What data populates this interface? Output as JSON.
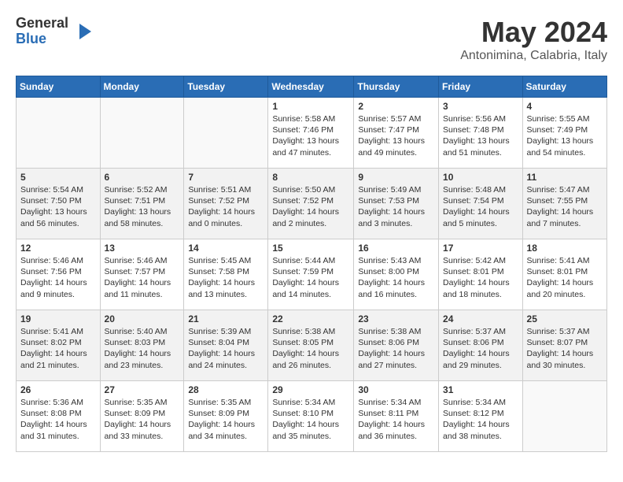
{
  "logo": {
    "general": "General",
    "blue": "Blue"
  },
  "title": "May 2024",
  "location": "Antonimina, Calabria, Italy",
  "days_of_week": [
    "Sunday",
    "Monday",
    "Tuesday",
    "Wednesday",
    "Thursday",
    "Friday",
    "Saturday"
  ],
  "weeks": [
    [
      {
        "day": "",
        "info": ""
      },
      {
        "day": "",
        "info": ""
      },
      {
        "day": "",
        "info": ""
      },
      {
        "day": "1",
        "info": "Sunrise: 5:58 AM\nSunset: 7:46 PM\nDaylight: 13 hours\nand 47 minutes."
      },
      {
        "day": "2",
        "info": "Sunrise: 5:57 AM\nSunset: 7:47 PM\nDaylight: 13 hours\nand 49 minutes."
      },
      {
        "day": "3",
        "info": "Sunrise: 5:56 AM\nSunset: 7:48 PM\nDaylight: 13 hours\nand 51 minutes."
      },
      {
        "day": "4",
        "info": "Sunrise: 5:55 AM\nSunset: 7:49 PM\nDaylight: 13 hours\nand 54 minutes."
      }
    ],
    [
      {
        "day": "5",
        "info": "Sunrise: 5:54 AM\nSunset: 7:50 PM\nDaylight: 13 hours\nand 56 minutes."
      },
      {
        "day": "6",
        "info": "Sunrise: 5:52 AM\nSunset: 7:51 PM\nDaylight: 13 hours\nand 58 minutes."
      },
      {
        "day": "7",
        "info": "Sunrise: 5:51 AM\nSunset: 7:52 PM\nDaylight: 14 hours\nand 0 minutes."
      },
      {
        "day": "8",
        "info": "Sunrise: 5:50 AM\nSunset: 7:52 PM\nDaylight: 14 hours\nand 2 minutes."
      },
      {
        "day": "9",
        "info": "Sunrise: 5:49 AM\nSunset: 7:53 PM\nDaylight: 14 hours\nand 3 minutes."
      },
      {
        "day": "10",
        "info": "Sunrise: 5:48 AM\nSunset: 7:54 PM\nDaylight: 14 hours\nand 5 minutes."
      },
      {
        "day": "11",
        "info": "Sunrise: 5:47 AM\nSunset: 7:55 PM\nDaylight: 14 hours\nand 7 minutes."
      }
    ],
    [
      {
        "day": "12",
        "info": "Sunrise: 5:46 AM\nSunset: 7:56 PM\nDaylight: 14 hours\nand 9 minutes."
      },
      {
        "day": "13",
        "info": "Sunrise: 5:46 AM\nSunset: 7:57 PM\nDaylight: 14 hours\nand 11 minutes."
      },
      {
        "day": "14",
        "info": "Sunrise: 5:45 AM\nSunset: 7:58 PM\nDaylight: 14 hours\nand 13 minutes."
      },
      {
        "day": "15",
        "info": "Sunrise: 5:44 AM\nSunset: 7:59 PM\nDaylight: 14 hours\nand 14 minutes."
      },
      {
        "day": "16",
        "info": "Sunrise: 5:43 AM\nSunset: 8:00 PM\nDaylight: 14 hours\nand 16 minutes."
      },
      {
        "day": "17",
        "info": "Sunrise: 5:42 AM\nSunset: 8:01 PM\nDaylight: 14 hours\nand 18 minutes."
      },
      {
        "day": "18",
        "info": "Sunrise: 5:41 AM\nSunset: 8:01 PM\nDaylight: 14 hours\nand 20 minutes."
      }
    ],
    [
      {
        "day": "19",
        "info": "Sunrise: 5:41 AM\nSunset: 8:02 PM\nDaylight: 14 hours\nand 21 minutes."
      },
      {
        "day": "20",
        "info": "Sunrise: 5:40 AM\nSunset: 8:03 PM\nDaylight: 14 hours\nand 23 minutes."
      },
      {
        "day": "21",
        "info": "Sunrise: 5:39 AM\nSunset: 8:04 PM\nDaylight: 14 hours\nand 24 minutes."
      },
      {
        "day": "22",
        "info": "Sunrise: 5:38 AM\nSunset: 8:05 PM\nDaylight: 14 hours\nand 26 minutes."
      },
      {
        "day": "23",
        "info": "Sunrise: 5:38 AM\nSunset: 8:06 PM\nDaylight: 14 hours\nand 27 minutes."
      },
      {
        "day": "24",
        "info": "Sunrise: 5:37 AM\nSunset: 8:06 PM\nDaylight: 14 hours\nand 29 minutes."
      },
      {
        "day": "25",
        "info": "Sunrise: 5:37 AM\nSunset: 8:07 PM\nDaylight: 14 hours\nand 30 minutes."
      }
    ],
    [
      {
        "day": "26",
        "info": "Sunrise: 5:36 AM\nSunset: 8:08 PM\nDaylight: 14 hours\nand 31 minutes."
      },
      {
        "day": "27",
        "info": "Sunrise: 5:35 AM\nSunset: 8:09 PM\nDaylight: 14 hours\nand 33 minutes."
      },
      {
        "day": "28",
        "info": "Sunrise: 5:35 AM\nSunset: 8:09 PM\nDaylight: 14 hours\nand 34 minutes."
      },
      {
        "day": "29",
        "info": "Sunrise: 5:34 AM\nSunset: 8:10 PM\nDaylight: 14 hours\nand 35 minutes."
      },
      {
        "day": "30",
        "info": "Sunrise: 5:34 AM\nSunset: 8:11 PM\nDaylight: 14 hours\nand 36 minutes."
      },
      {
        "day": "31",
        "info": "Sunrise: 5:34 AM\nSunset: 8:12 PM\nDaylight: 14 hours\nand 38 minutes."
      },
      {
        "day": "",
        "info": ""
      }
    ]
  ]
}
